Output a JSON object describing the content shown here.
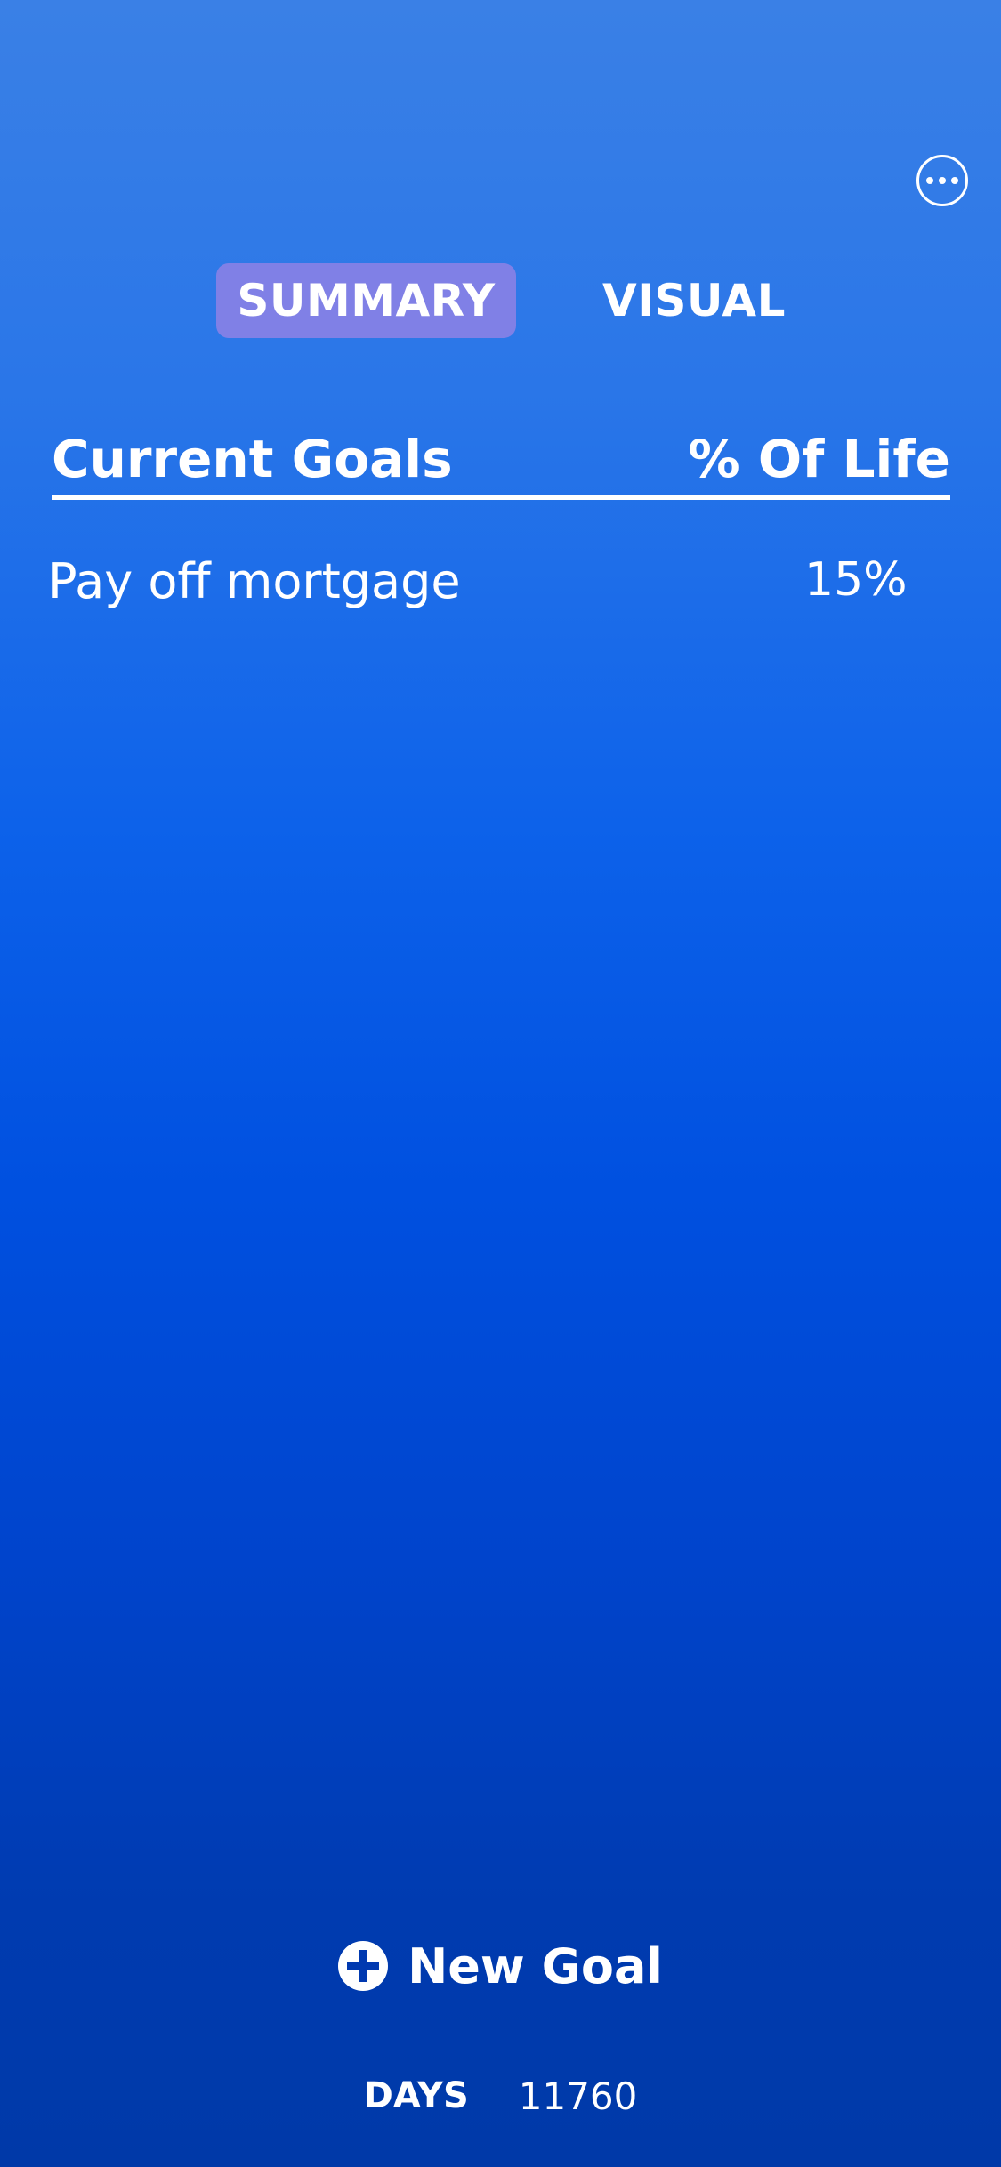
{
  "header": {
    "more_icon": "ellipsis-icon"
  },
  "tabs": [
    {
      "label": "SUMMARY",
      "selected": true,
      "color": "#8080e6"
    },
    {
      "label": "VISUAL",
      "selected": false
    }
  ],
  "table": {
    "headers": {
      "goal": "Current Goals",
      "percent": "% Of Life"
    },
    "rows": [
      {
        "goal": "Pay off mortgage",
        "percent": "15%"
      }
    ]
  },
  "footer": {
    "new_goal_label": "New Goal",
    "new_goal_icon": "plus-circle-icon",
    "days_label": "DAYS",
    "days_value": "11760"
  }
}
